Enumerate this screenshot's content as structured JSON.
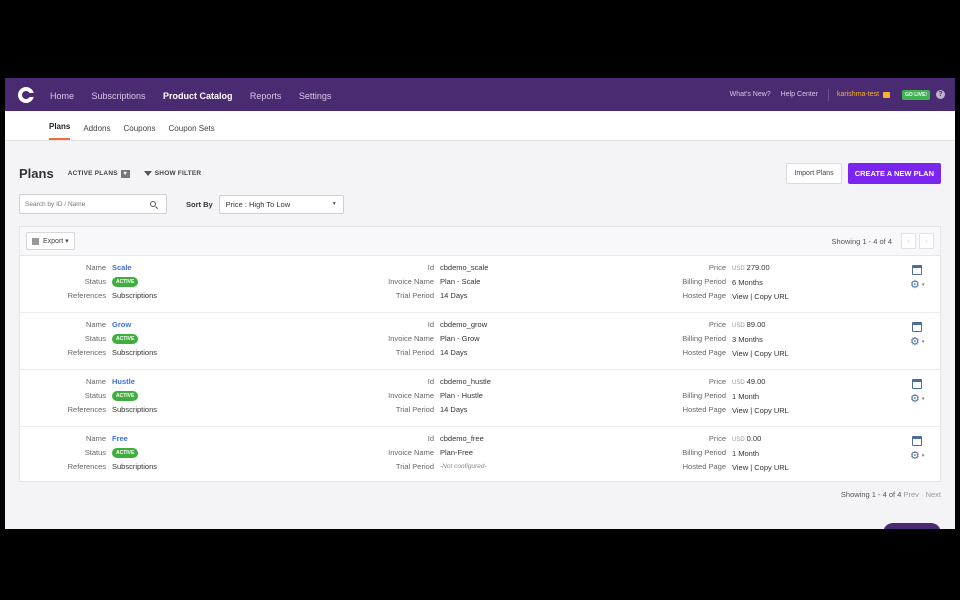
{
  "topnav": {
    "items": [
      {
        "label": "Home"
      },
      {
        "label": "Subscriptions"
      },
      {
        "label": "Product Catalog",
        "active": true
      },
      {
        "label": "Reports"
      },
      {
        "label": "Settings"
      }
    ],
    "whats_new": "What's New?",
    "help_center": "Help Center",
    "user": "karishma-test",
    "live_badge": "GO LIVE!",
    "help_icon": "?"
  },
  "subnav": {
    "items": [
      {
        "label": "Plans",
        "active": true
      },
      {
        "label": "Addons"
      },
      {
        "label": "Coupons"
      },
      {
        "label": "Coupon Sets"
      }
    ]
  },
  "page": {
    "title": "Plans",
    "filter_active": "ACTIVE PLANS",
    "show_filter": "SHOW FILTER",
    "import_button": "Import Plans",
    "create_button": "CREATE A NEW PLAN"
  },
  "search": {
    "placeholder": "Search by ID / Name",
    "sort_label": "Sort By",
    "sort_value": "Price : High To Low"
  },
  "toolbar": {
    "export_label": "Export",
    "showing": "Showing 1 - 4 of 4"
  },
  "labels": {
    "name": "Name",
    "status": "Status",
    "references": "References",
    "id": "Id",
    "invoice_name": "Invoice Name",
    "trial_period": "Trial Period",
    "price": "Price",
    "billing_period": "Billing Period",
    "hosted_page": "Hosted Page"
  },
  "plans": [
    {
      "name": "Scale",
      "status": "ACTIVE",
      "references": "Subscriptions",
      "id": "cbdemo_scale",
      "invoice_name": "Plan - Scale",
      "trial_period": "14 Days",
      "currency": "USD",
      "price": "279.00",
      "billing_period": "6 Months",
      "hosted_view": "View",
      "hosted_copy": "Copy URL"
    },
    {
      "name": "Grow",
      "status": "ACTIVE",
      "references": "Subscriptions",
      "id": "cbdemo_grow",
      "invoice_name": "Plan - Grow",
      "trial_period": "14 Days",
      "currency": "USD",
      "price": "89.00",
      "billing_period": "3 Months",
      "hosted_view": "View",
      "hosted_copy": "Copy URL"
    },
    {
      "name": "Hustle",
      "status": "ACTIVE",
      "references": "Subscriptions",
      "id": "cbdemo_hustle",
      "invoice_name": "Plan - Hustle",
      "trial_period": "14 Days",
      "currency": "USD",
      "price": "49.00",
      "billing_period": "1 Month",
      "hosted_view": "View",
      "hosted_copy": "Copy URL"
    },
    {
      "name": "Free",
      "status": "ACTIVE",
      "references": "Subscriptions",
      "id": "cbdemo_free",
      "invoice_name": "Plan-Free",
      "trial_period": "-Not configured-",
      "currency": "USD",
      "price": "0.00",
      "billing_period": "1 Month",
      "hosted_view": "View",
      "hosted_copy": "Copy URL"
    }
  ],
  "footer": {
    "showing": "Showing 1 - 4 of 4",
    "prev": "Prev",
    "sep": " · ",
    "next": "Next"
  },
  "icons": [
    "logo-icon",
    "caret-down-icon",
    "filter-icon",
    "search-icon",
    "export-icon",
    "chevron-left-icon",
    "chevron-right-icon",
    "calendar-icon",
    "gear-icon",
    "help-icon",
    "chat-icon"
  ],
  "colors": {
    "topbar": "#4a2b72",
    "primary": "#7a24f0",
    "link": "#3b6fd8",
    "active_badge": "#3fae3f",
    "tab_underline": "#f26b3a"
  }
}
